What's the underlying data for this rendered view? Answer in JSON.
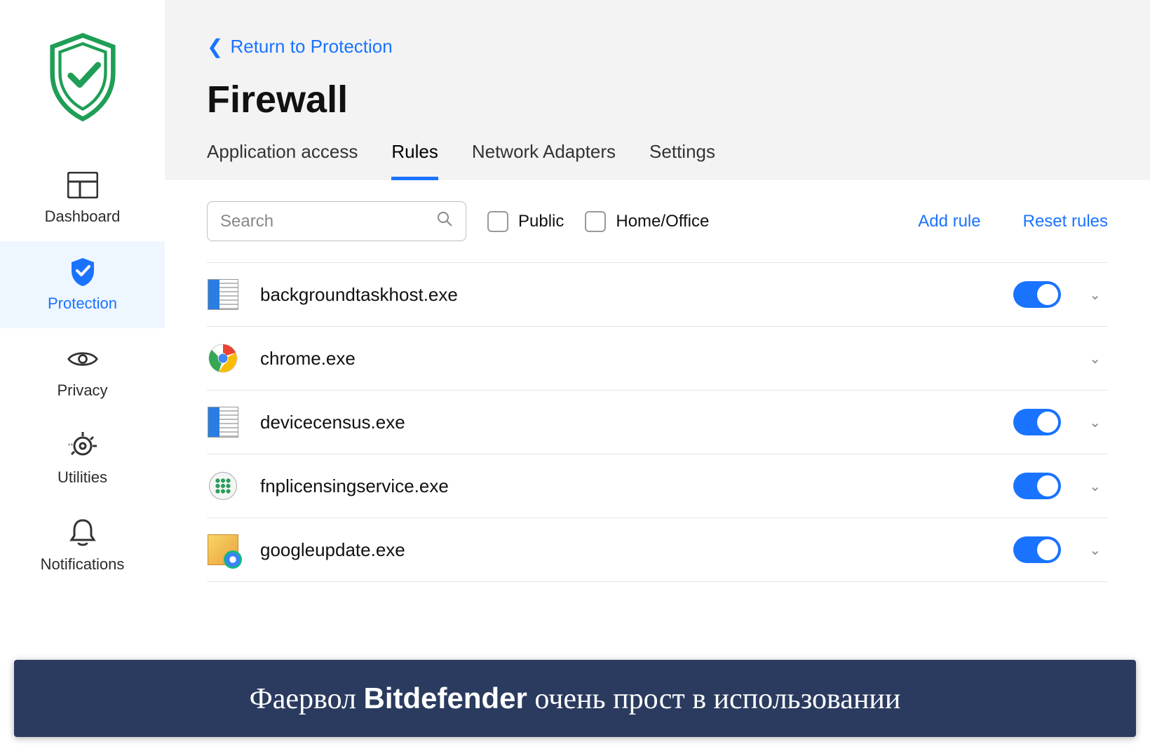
{
  "sidebar": {
    "items": [
      {
        "id": "dashboard",
        "label": "Dashboard",
        "active": false
      },
      {
        "id": "protection",
        "label": "Protection",
        "active": true
      },
      {
        "id": "privacy",
        "label": "Privacy",
        "active": false
      },
      {
        "id": "utilities",
        "label": "Utilities",
        "active": false
      },
      {
        "id": "notifications",
        "label": "Notifications",
        "active": false
      }
    ]
  },
  "header": {
    "back_label": "Return to Protection",
    "title": "Firewall",
    "tabs": [
      {
        "id": "app-access",
        "label": "Application access",
        "active": false
      },
      {
        "id": "rules",
        "label": "Rules",
        "active": true
      },
      {
        "id": "adapters",
        "label": "Network Adapters",
        "active": false
      },
      {
        "id": "settings",
        "label": "Settings",
        "active": false
      }
    ]
  },
  "filters": {
    "search_placeholder": "Search",
    "public_label": "Public",
    "home_office_label": "Home/Office",
    "add_rule_label": "Add rule",
    "reset_rules_label": "Reset rules"
  },
  "rules": [
    {
      "icon": "windows-app",
      "name": "backgroundtaskhost.exe",
      "toggle": true
    },
    {
      "icon": "chrome",
      "name": "chrome.exe",
      "toggle": null
    },
    {
      "icon": "windows-app",
      "name": "devicecensus.exe",
      "toggle": true
    },
    {
      "icon": "grid-app",
      "name": "fnplicensingservice.exe",
      "toggle": true
    },
    {
      "icon": "gupdate",
      "name": "googleupdate.exe",
      "toggle": true
    }
  ],
  "caption": {
    "prefix": "Фаервол ",
    "brand": "Bitdefender",
    "suffix": " очень прост в использовании"
  }
}
